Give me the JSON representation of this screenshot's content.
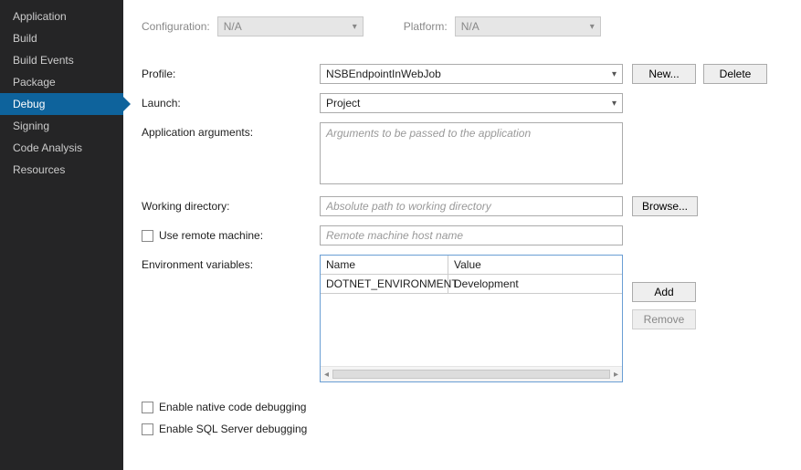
{
  "sidebar": {
    "items": [
      {
        "label": "Application",
        "active": false
      },
      {
        "label": "Build",
        "active": false
      },
      {
        "label": "Build Events",
        "active": false
      },
      {
        "label": "Package",
        "active": false
      },
      {
        "label": "Debug",
        "active": true
      },
      {
        "label": "Signing",
        "active": false
      },
      {
        "label": "Code Analysis",
        "active": false
      },
      {
        "label": "Resources",
        "active": false
      }
    ]
  },
  "top": {
    "config_label": "Configuration:",
    "config_value": "N/A",
    "platform_label": "Platform:",
    "platform_value": "N/A"
  },
  "form": {
    "profile_label": "Profile:",
    "profile_value": "NSBEndpointInWebJob",
    "new_btn": "New...",
    "delete_btn": "Delete",
    "launch_label": "Launch:",
    "launch_value": "Project",
    "args_label": "Application arguments:",
    "args_placeholder": "Arguments to be passed to the application",
    "workdir_label": "Working directory:",
    "workdir_placeholder": "Absolute path to working directory",
    "browse_btn": "Browse...",
    "remote_chk": "Use remote machine:",
    "remote_placeholder": "Remote machine host name",
    "env_label": "Environment variables:",
    "env_head_name": "Name",
    "env_head_value": "Value",
    "add_btn": "Add",
    "remove_btn": "Remove",
    "native_chk": "Enable native code debugging",
    "sql_chk": "Enable SQL Server debugging"
  },
  "env_rows": [
    {
      "name": "DOTNET_ENVIRONMENT",
      "value": "Development"
    }
  ]
}
